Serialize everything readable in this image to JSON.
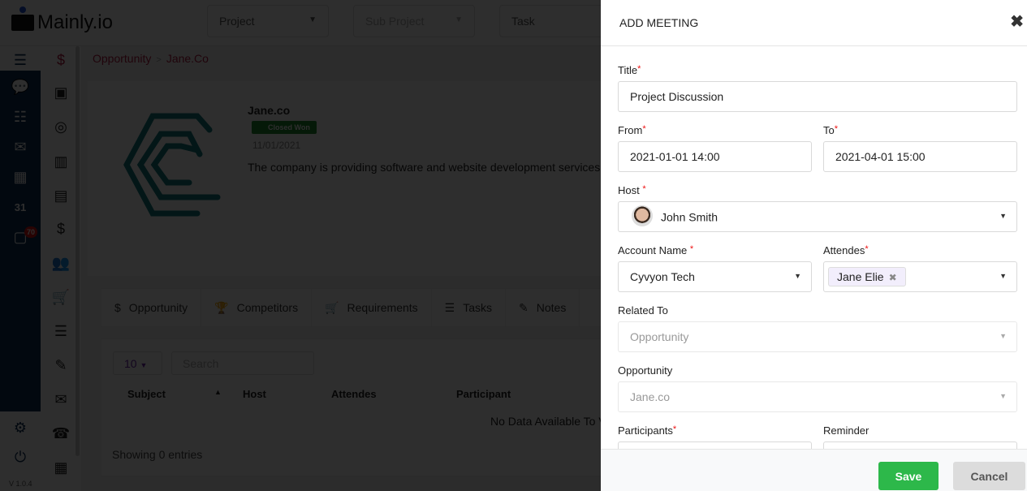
{
  "app": {
    "logo": "Mainly.io",
    "version": "V 1.0.4",
    "notification_count": "70"
  },
  "topbar": {
    "project": "Project",
    "sub_project": "Sub Project",
    "task": "Task"
  },
  "breadcrumb": {
    "parent": "Opportunity",
    "separator": ">",
    "current": "Jane.Co"
  },
  "company": {
    "name": "Jane.co",
    "status": "Closed Won",
    "date": "11/01/2021",
    "description": "The company is providing software and website development services"
  },
  "tabs": [
    "Opportunity",
    "Competitors",
    "Requirements",
    "Tasks",
    "Notes"
  ],
  "table": {
    "page_length": "10",
    "search_placeholder": "Search",
    "headers": [
      "Subject",
      "Host",
      "Attendes",
      "Participant"
    ],
    "empty": "No Data Available To View",
    "showing": "Showing 0 entries"
  },
  "modal": {
    "title": "ADD MEETING",
    "close": "✖",
    "fields": {
      "title": {
        "label": "Title",
        "value": "Project Discussion"
      },
      "from": {
        "label": "From",
        "value": "2021-01-01 14:00"
      },
      "to": {
        "label": "To",
        "value": "2021-04-01 15:00"
      },
      "host": {
        "label": "Host",
        "value": "John Smith"
      },
      "account": {
        "label": "Account Name",
        "value": "Cyvyon Tech"
      },
      "attendes": {
        "label": "Attendes",
        "chips": [
          "Jane Elie"
        ]
      },
      "related": {
        "label": "Related To",
        "value": "Opportunity"
      },
      "opportunity": {
        "label": "Opportunity",
        "value": "Jane.co"
      },
      "participants": {
        "label": "Participants"
      },
      "reminder": {
        "label": "Reminder"
      }
    },
    "save": "Save",
    "cancel": "Cancel"
  },
  "colors": {
    "save": "#2db84a",
    "cancel": "#dcdcdc",
    "required": "#e11d1d",
    "brand_nav": "#0a2a55",
    "status": "#1d8a2c"
  }
}
